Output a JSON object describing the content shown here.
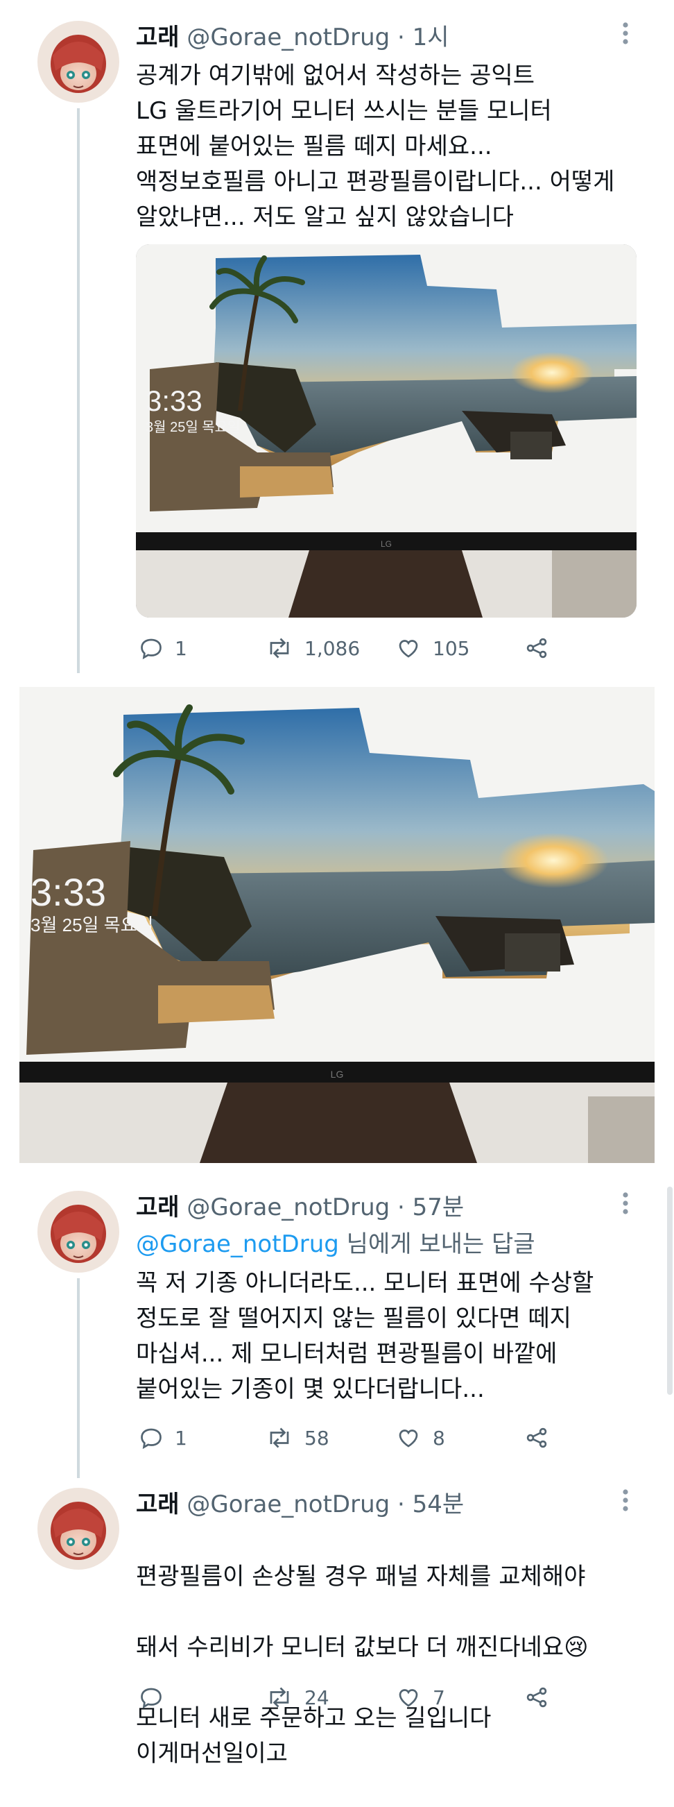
{
  "colors": {
    "accent": "#1d9bf0",
    "text": "#0f1419",
    "secondary": "#536471",
    "thread": "#cfd9de"
  },
  "tweets": [
    {
      "name": "고래",
      "handle": "@Gorae_notDrug",
      "separator": "·",
      "time": "1시",
      "text": "공계가 여기밖에 없어서 작성하는 공익트\nLG 울트라기어 모니터 쓰시는 분들 모니터\n표면에 붙어있는 필름 떼지 마세요...\n액정보호필름 아니고 편광필름이랍니다... 어떻게\n알았냐면... 저도 알고 싶지 않았습니다",
      "replies": "1",
      "retweets": "1,086",
      "likes": "105"
    },
    {
      "name": "고래",
      "handle": "@Gorae_notDrug",
      "separator": "·",
      "time": "57분",
      "reply_to_handle": "@Gorae_notDrug",
      "reply_to_suffix": " 님에게 보내는 답글",
      "text": "꼭 저 기종 아니더라도... 모니터 표면에 수상할\n정도로 잘 떨어지지 않는 필름이 있다면 떼지\n마십셔... 제 모니터처럼 편광필름이 바깥에\n붙어있는 기종이 몇 있다더랍니다...",
      "replies": "1",
      "retweets": "58",
      "likes": "8"
    },
    {
      "name": "고래",
      "handle": "@Gorae_notDrug",
      "separator": "·",
      "time": "54분",
      "text_line1": "편광필름이 손상될 경우 패널 자체를 교체해야",
      "text_line2": "돼서 수리비가 모니터 값보다 더 깨진다네요",
      "emoji": "😢",
      "text_rest": "모니터 새로 주문하고 오는 길입니다\n이게머선일이고",
      "replies": "",
      "retweets": "24",
      "likes": "7"
    }
  ],
  "photo_screen": {
    "clock": "3:33",
    "date": "3월 25일 목요일",
    "brand": "LG"
  },
  "icons": {
    "reply": "reply-icon",
    "retweet": "retweet-icon",
    "like": "heart-icon",
    "share": "share-icon",
    "more": "more-icon"
  }
}
